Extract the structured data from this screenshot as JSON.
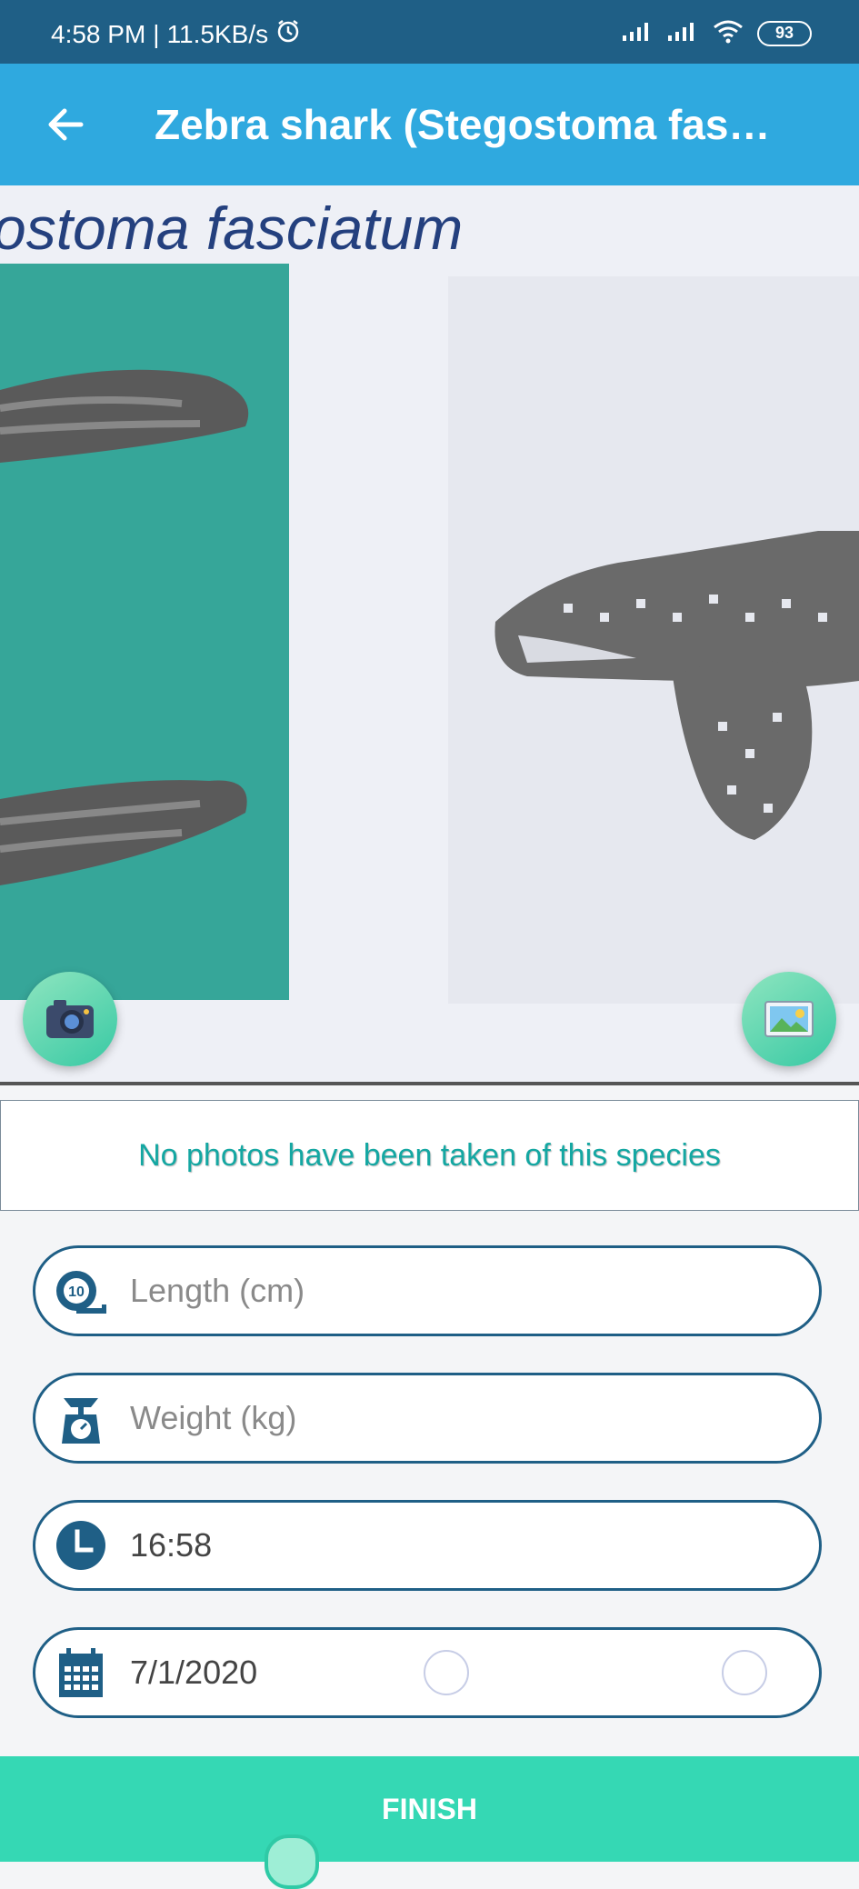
{
  "status_bar": {
    "time": "4:58 PM",
    "net_speed": "11.5KB/s",
    "battery": "93"
  },
  "app_bar": {
    "title": "Zebra shark (Stegostoma fasci..."
  },
  "photo": {
    "caption": "ostoma fasciatum"
  },
  "notice": "No photos have been taken of this species",
  "form": {
    "length_placeholder": "Length (cm)",
    "length_icon_text": "10",
    "weight_placeholder": "Weight (kg)",
    "time_value": "16:58",
    "date_value": "7/1/2020"
  },
  "finish_label": "FINISH",
  "colors": {
    "status_bar": "#1f5f86",
    "app_bar": "#2fa9df",
    "accent": "#35d8b4",
    "notice_text": "#14a7a2",
    "field_border": "#1f5f86"
  },
  "icons": [
    "back-arrow-icon",
    "alarm-icon",
    "signal-icon",
    "wifi-icon",
    "camera-icon",
    "gallery-icon",
    "tape-measure-icon",
    "scale-icon",
    "clock-icon",
    "calendar-icon"
  ]
}
